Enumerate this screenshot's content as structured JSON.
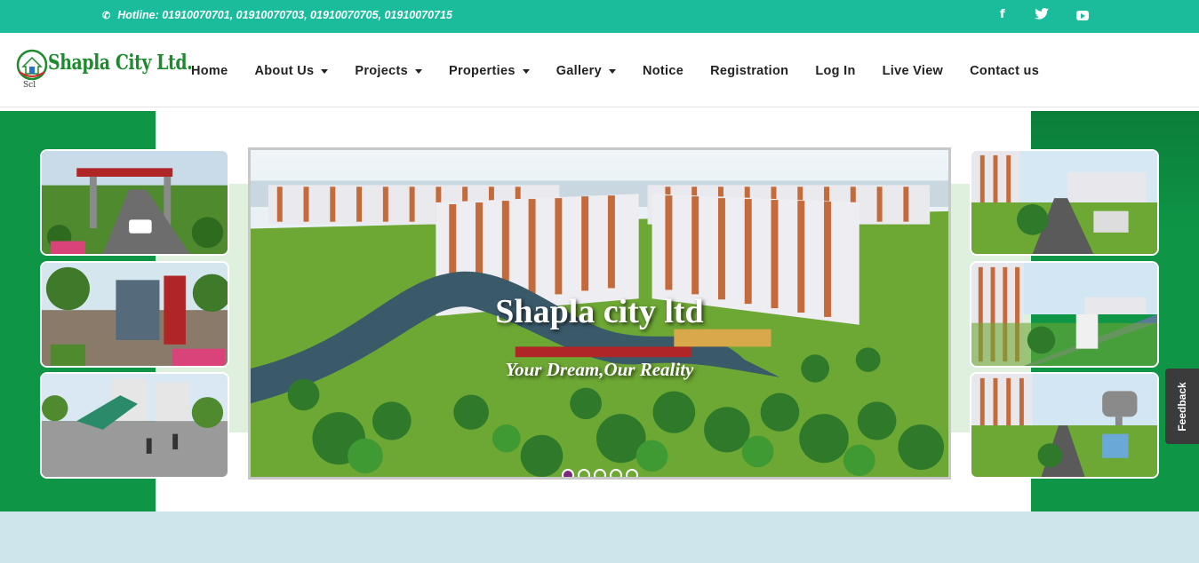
{
  "topbar": {
    "hotline": "Hotline: 01910070701, 01910070703, 01910070705, 01910070715",
    "social": [
      "facebook-icon",
      "twitter-icon",
      "youtube-icon"
    ],
    "color": "#1abc9c"
  },
  "logo": {
    "text": "Shapla City Ltd.",
    "sub": "Scl"
  },
  "nav": {
    "home": "Home",
    "about": "About Us",
    "projects": "Projects",
    "properties": "Properties",
    "gallery": "Gallery",
    "notice": "Notice",
    "registration": "Registration",
    "login": "Log In",
    "live": "Live View",
    "contact": "Contact us"
  },
  "hero": {
    "title": "Shapla city ltd",
    "tagline": "Your Dream,Our Reality",
    "slides_total": 5,
    "active_slide": 1,
    "accent_green": "#0e9546"
  },
  "feedback": "Feedback"
}
